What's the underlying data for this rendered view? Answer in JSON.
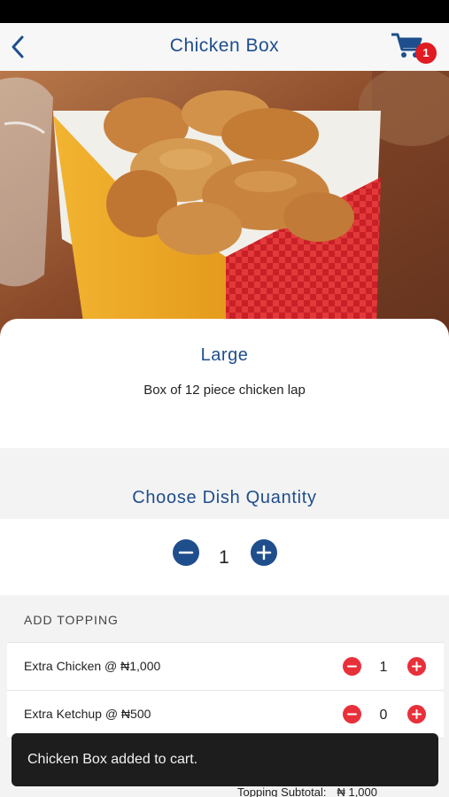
{
  "header": {
    "title": "Chicken Box",
    "cart_count": "1"
  },
  "product": {
    "variant": "Large",
    "description": "Box of 12 piece chicken lap"
  },
  "quantity": {
    "heading": "Choose Dish Quantity",
    "value": "1"
  },
  "toppings": {
    "header": "ADD TOPPING",
    "items": [
      {
        "label": "Extra Chicken @ ₦1,000",
        "qty": "1"
      },
      {
        "label": "Extra Ketchup @ ₦500",
        "qty": "0"
      }
    ],
    "subtotal_label": "Topping Subtotal:",
    "subtotal_value": "₦ 1,000"
  },
  "toast": {
    "message": "Chicken Box added to cart."
  },
  "colors": {
    "primary": "#1f4e8c",
    "accent_red": "#e8303a",
    "badge_red": "#e01b22"
  },
  "icons": {
    "back": "chevron-left-icon",
    "cart": "shopping-cart-icon",
    "minus": "minus-circle-icon",
    "plus": "plus-circle-icon"
  }
}
